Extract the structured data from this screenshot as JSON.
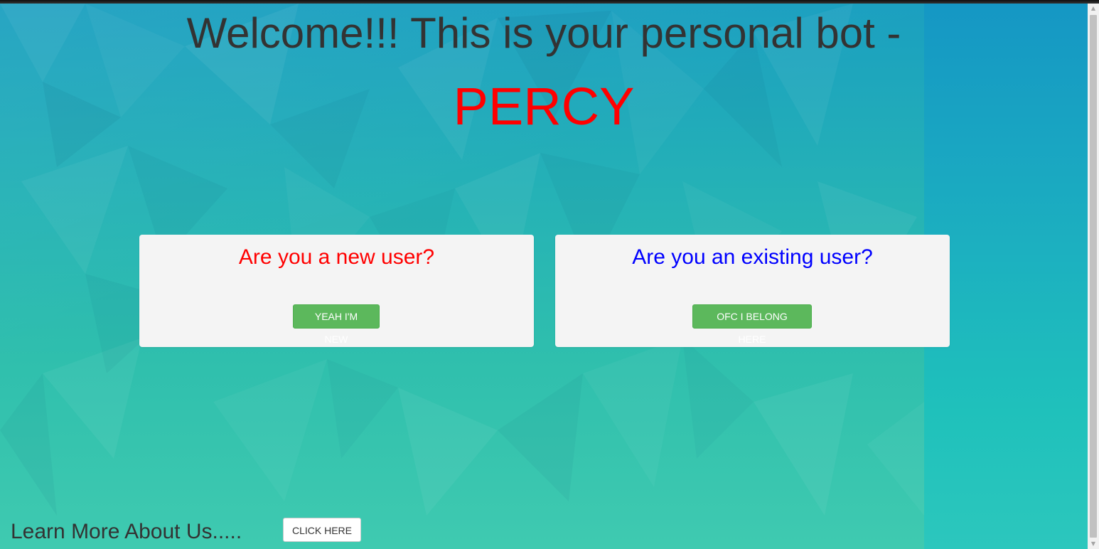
{
  "header": {
    "welcome_text": "Welcome!!! This is your personal bot -",
    "bot_name": "PERCY"
  },
  "new_user_panel": {
    "question": "Are you a new user?",
    "button_label": "YEAH I'M NEW"
  },
  "existing_user_panel": {
    "question": "Are you an existing user?",
    "button_label": "OFC I BELONG HERE"
  },
  "footer": {
    "learn_more_text": "Learn More About Us.....",
    "click_button_label": "CLICK HERE"
  },
  "scrollbar": {
    "up_arrow_icon": "triangle-up-icon",
    "down_arrow_icon": "triangle-down-icon"
  },
  "colors": {
    "bot_name": "#ff0000",
    "new_user_question": "#ff0000",
    "existing_user_question": "#0000ff",
    "primary_button": "#5cb85c",
    "panel_background": "#f4f4f4"
  }
}
